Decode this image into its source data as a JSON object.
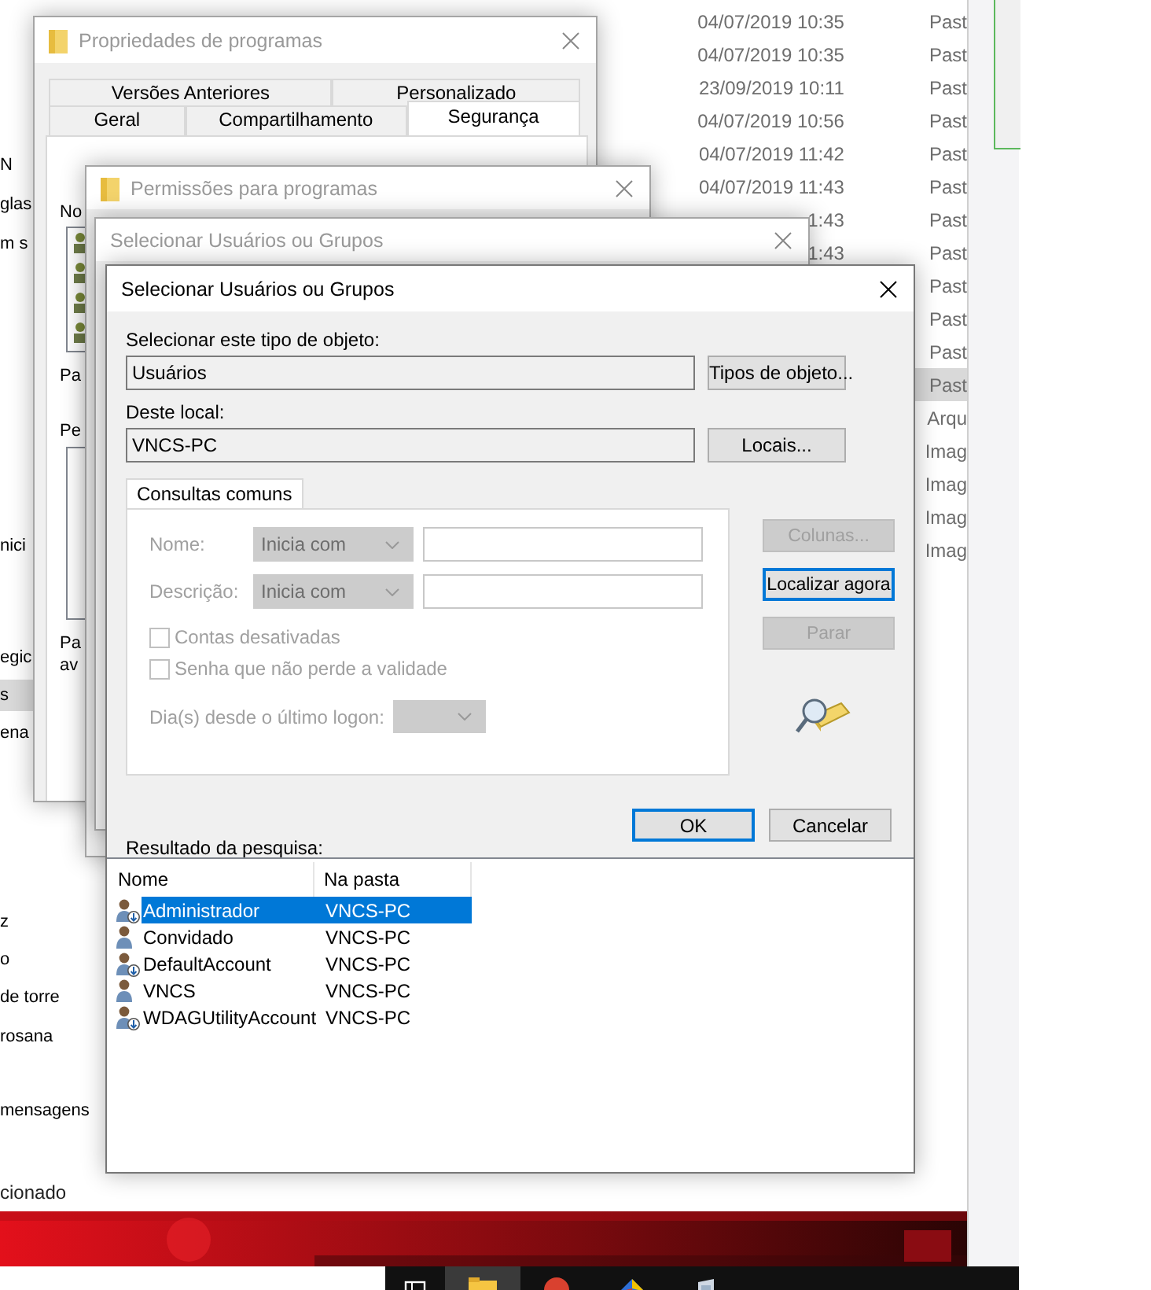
{
  "explorer": {
    "sidebar_items": [
      {
        "label": "N",
        "selected": false
      },
      {
        "label": "glas",
        "selected": false
      },
      {
        "label": "m s",
        "selected": false
      },
      {
        "label": "nici",
        "selected": false
      },
      {
        "label": "egic",
        "selected": false
      },
      {
        "label": "s",
        "selected": true
      },
      {
        "label": "ena",
        "selected": false
      },
      {
        "label": "z",
        "selected": false
      },
      {
        "label": "o",
        "selected": false
      },
      {
        "label": "de torre",
        "selected": false
      },
      {
        "label": "rosana",
        "selected": false
      },
      {
        "label": "mensagens",
        "selected": false
      }
    ],
    "status_bar": "cionado",
    "files": [
      {
        "date": "04/07/2019 10:35",
        "type": "Past",
        "selected": false
      },
      {
        "date": "04/07/2019 10:35",
        "type": "Past",
        "selected": false
      },
      {
        "date": "23/09/2019 10:11",
        "type": "Past",
        "selected": false
      },
      {
        "date": "04/07/2019 10:56",
        "type": "Past",
        "selected": false
      },
      {
        "date": "04/07/2019 11:42",
        "type": "Past",
        "selected": false
      },
      {
        "date": "04/07/2019 11:43",
        "type": "Past",
        "selected": false
      },
      {
        "date": "1:43",
        "type": "Past",
        "selected": false
      },
      {
        "date": "1:43",
        "type": "Past",
        "selected": false
      },
      {
        "type": "Past",
        "selected": false
      },
      {
        "type": "Past",
        "selected": false
      },
      {
        "type": "Past",
        "selected": false
      },
      {
        "type": "Past",
        "selected": true
      },
      {
        "type": "Arqu",
        "selected": false
      },
      {
        "type": "Imag",
        "selected": false
      },
      {
        "type": "Imag",
        "selected": false
      },
      {
        "type": "Imag",
        "selected": false
      },
      {
        "type": "Imag",
        "selected": false
      }
    ]
  },
  "windows": [
    {
      "kind": "properties",
      "title": "Propriedades de programas",
      "active": false,
      "tab_rows": [
        [
          {
            "label": "Versões Anteriores",
            "selected": false
          },
          {
            "label": "Personalizado",
            "selected": false
          }
        ],
        [
          {
            "label": "Geral",
            "selected": false
          },
          {
            "label": "Compartilhamento",
            "selected": false
          },
          {
            "label": "Segurança",
            "selected": true
          }
        ]
      ],
      "fragments": [
        "No",
        "Pa",
        "Pe",
        "Pa",
        "av"
      ]
    },
    {
      "kind": "permissions",
      "title": "Permissões para programas",
      "active": false
    },
    {
      "kind": "select",
      "title": "Selecionar Usuários ou Grupos",
      "active": false
    }
  ],
  "dialog": {
    "title": "Selecionar Usuários ou Grupos",
    "active": true,
    "object_type": {
      "label": "Selecionar este tipo de objeto:",
      "value": "Usuários",
      "button": "Tipos de objeto..."
    },
    "location": {
      "label": "Deste local:",
      "value": "VNCS-PC",
      "button": "Locais..."
    },
    "query_tab": "Consultas comuns",
    "query_disabled": true,
    "query_fields": [
      {
        "label": "Nome:",
        "operator": "Inicia com"
      },
      {
        "label": "Descrição:",
        "operator": "Inicia com"
      }
    ],
    "checkboxes": [
      {
        "label": "Contas desativadas",
        "checked": false
      },
      {
        "label": "Senha que não perde a validade",
        "checked": false
      }
    ],
    "days_label": "Dia(s) desde o último logon:",
    "side_buttons": [
      {
        "label": "Colunas...",
        "disabled": true,
        "focused": false
      },
      {
        "label": "Localizar agora",
        "disabled": false,
        "focused": true
      },
      {
        "label": "Parar",
        "disabled": true,
        "focused": false
      }
    ],
    "buttons": [
      {
        "label": "OK",
        "default": true
      },
      {
        "label": "Cancelar",
        "default": false
      }
    ],
    "results_label": "Resultado da pesquisa:",
    "results": {
      "columns": [
        "Nome",
        "Na pasta"
      ],
      "rows": [
        {
          "name": "Administrador",
          "folder": "VNCS-PC",
          "disabled": true,
          "selected": true
        },
        {
          "name": "Convidado",
          "folder": "VNCS-PC",
          "disabled": false,
          "selected": false
        },
        {
          "name": "DefaultAccount",
          "folder": "VNCS-PC",
          "disabled": true,
          "selected": false
        },
        {
          "name": "VNCS",
          "folder": "VNCS-PC",
          "disabled": false,
          "selected": false
        },
        {
          "name": "WDAGUtilityAccount",
          "folder": "VNCS-PC",
          "disabled": true,
          "selected": false
        }
      ]
    }
  }
}
